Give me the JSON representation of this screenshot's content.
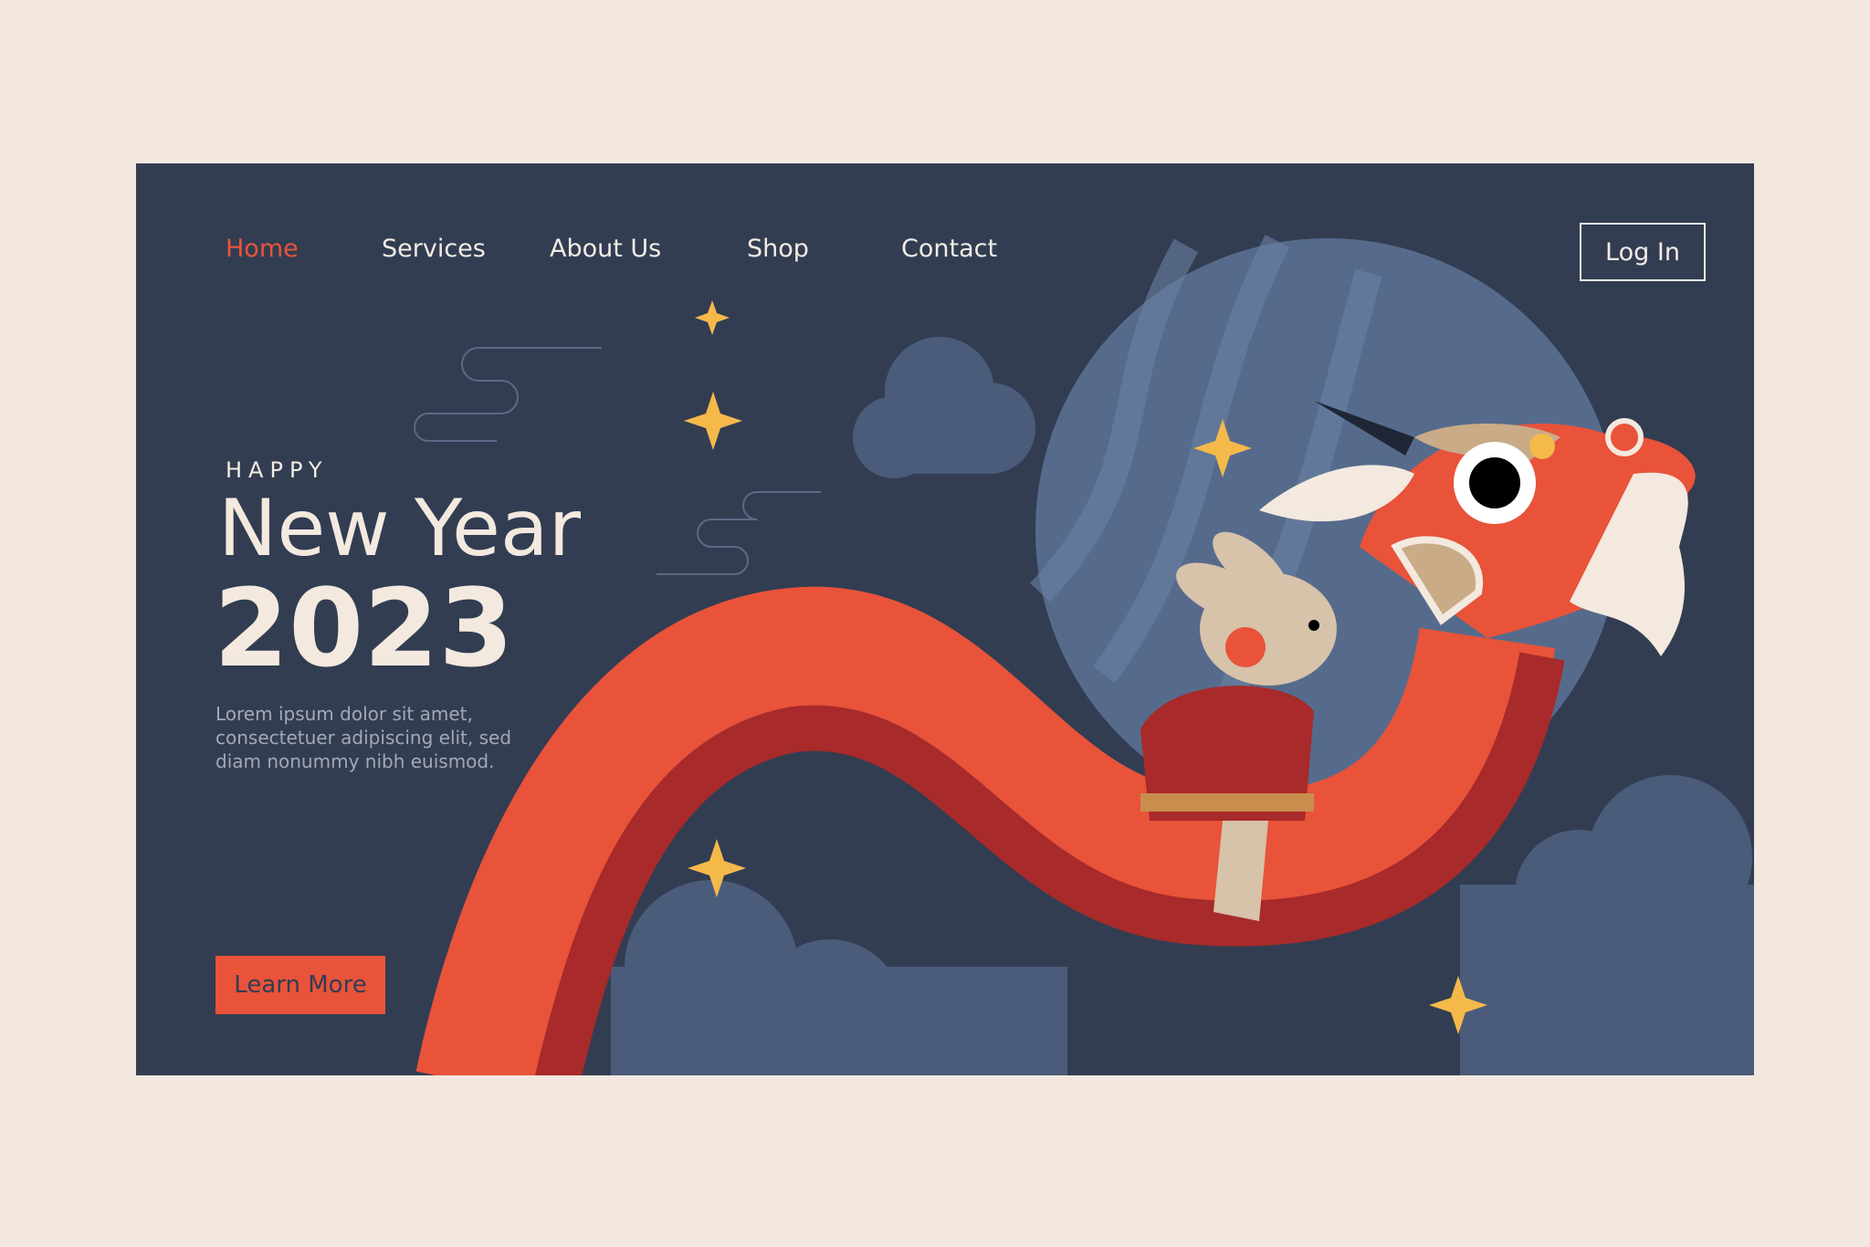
{
  "nav": {
    "items": [
      {
        "label": "Home",
        "active": true
      },
      {
        "label": "Services"
      },
      {
        "label": "About Us"
      },
      {
        "label": "Shop"
      },
      {
        "label": "Contact"
      }
    ],
    "login_label": "Log In"
  },
  "hero": {
    "eyebrow": "HAPPY",
    "title": "New Year",
    "year": "2023",
    "description": "Lorem ipsum dolor sit amet, consectetuer adipiscing elit, sed diam nonummy nibh euismod.",
    "cta_label": "Learn More"
  },
  "colors": {
    "page_bg": "#f2e8df",
    "card_bg": "#323d52",
    "accent": "#e8533a",
    "moon": "#566b8c",
    "star": "#f5b94a",
    "cream": "#f3e9df"
  }
}
